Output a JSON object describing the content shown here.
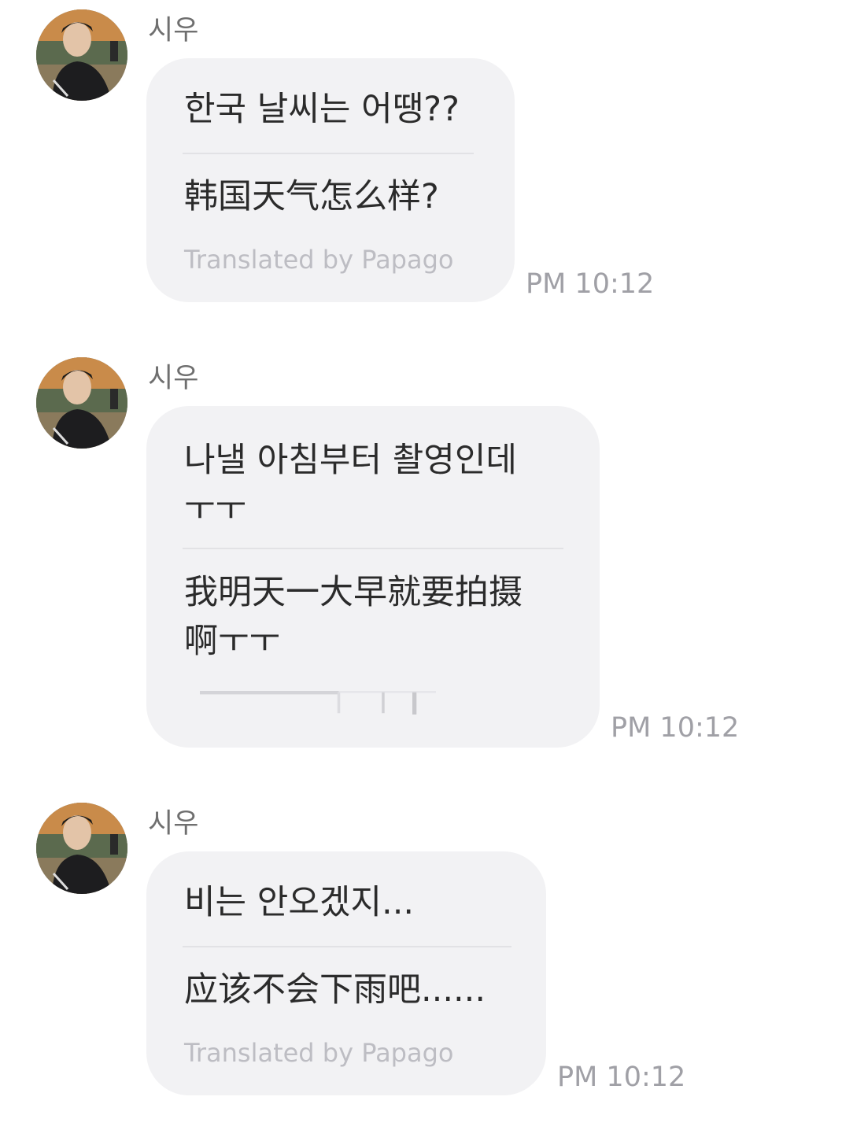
{
  "messages": [
    {
      "sender": "시우",
      "original": "한국 날씨는 어땡??",
      "translation": "韩国天气怎么样?",
      "credit": "Translated by Papago",
      "time": "PM 10:12"
    },
    {
      "sender": "시우",
      "original": "나낼 아침부터 촬영인데\nㅜㅜ",
      "translation": "我明天一大早就要拍摄\n啊ㅜㅜ",
      "credit": "",
      "time": "PM 10:12"
    },
    {
      "sender": "시우",
      "original": "비는 안오겠지...",
      "translation": "应该不会下雨吧......",
      "credit": "Translated by Papago",
      "time": "PM 10:12"
    }
  ]
}
